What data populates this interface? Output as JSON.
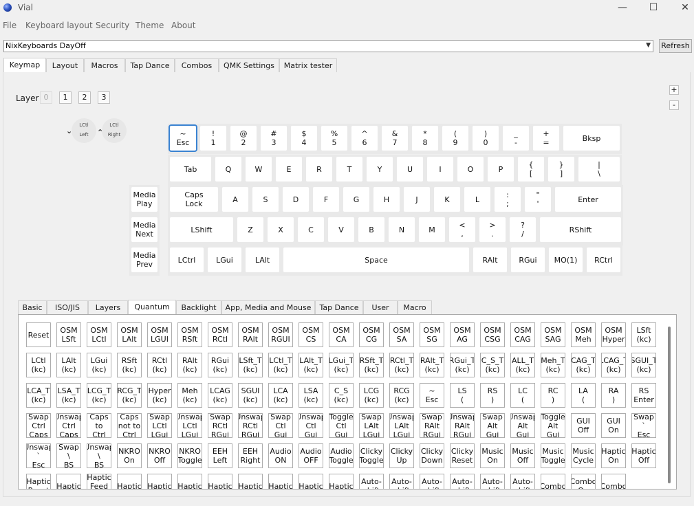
{
  "window": {
    "title": "Vial",
    "minimize": "—",
    "maximize": "☐",
    "close": "✕"
  },
  "menu": [
    "File",
    "Keyboard layout",
    "Security",
    "Theme",
    "About"
  ],
  "keyboard_selector": {
    "value": "NixKeyboards DayOff",
    "refresh_label": "Refresh"
  },
  "main_tabs": [
    "Keymap",
    "Layout",
    "Macros",
    "Tap Dance",
    "Combos",
    "QMK Settings",
    "Matrix tester"
  ],
  "active_main_tab": "Keymap",
  "layer": {
    "label": "Layer",
    "buttons": [
      "0",
      "1",
      "2",
      "3"
    ],
    "active": "0"
  },
  "zoom": {
    "plus": "+",
    "minus": "-"
  },
  "encoders": [
    {
      "top": "LCtl",
      "bottom": "Left"
    },
    {
      "top": "LCtl",
      "bottom": "Right"
    }
  ],
  "encoder_arrows": {
    "ccw": "⌄",
    "cw": "⌃"
  },
  "keymap_rows": [
    [
      "~\nEsc",
      "!\n1",
      "@\n2",
      "#\n3",
      "$\n4",
      "%\n5",
      "^\n6",
      "&\n7",
      "*\n8",
      "(\n9",
      ")\n0",
      "_\n-",
      "+\n=",
      "Bksp"
    ],
    [
      "Tab",
      "Q",
      "W",
      "E",
      "R",
      "T",
      "Y",
      "U",
      "I",
      "O",
      "P",
      "{\n[",
      "}\n]",
      "|\n\\"
    ],
    [
      "Media\nPlay",
      "Caps\nLock",
      "A",
      "S",
      "D",
      "F",
      "G",
      "H",
      "J",
      "K",
      "L",
      ":\n;",
      "\"\n'",
      "Enter"
    ],
    [
      "Media\nNext",
      "LShift",
      "Z",
      "X",
      "C",
      "V",
      "B",
      "N",
      "M",
      "<\n,",
      ">\n.",
      "?\n/",
      "RShift"
    ],
    [
      "Media\nPrev",
      "LCtrl",
      "LGui",
      "LAlt",
      "Space",
      "RAlt",
      "RGui",
      "MO(1)",
      "RCtrl"
    ]
  ],
  "sub_tabs": [
    "Basic",
    "ISO/JIS",
    "Layers",
    "Quantum",
    "Backlight",
    "App, Media and Mouse",
    "Tap Dance",
    "User",
    "Macro"
  ],
  "active_sub_tab": "Quantum",
  "quantum_keys": [
    [
      "Reset",
      "OSM\nLSft",
      "OSM\nLCtl",
      "OSM\nLAlt",
      "OSM\nLGUI",
      "OSM\nRSft",
      "OSM\nRCtl",
      "OSM\nRAlt",
      "OSM\nRGUI",
      "OSM\nCS",
      "OSM\nCA",
      "OSM\nCG",
      "OSM\nSA",
      "OSM\nSG",
      "OSM\nAG",
      "OSM\nCSG",
      "OSM\nCAG",
      "OSM\nSAG",
      "OSM\nMeh",
      "OSM\nHyper",
      "LSft\n(kc)"
    ],
    [
      "LCtl\n(kc)",
      "LAlt\n(kc)",
      "LGui\n(kc)",
      "RSft\n(kc)",
      "RCtl\n(kc)",
      "RAlt\n(kc)",
      "RGui\n(kc)",
      "LSft_T\n(kc)",
      "LCtl_T\n(kc)",
      "LAlt_T\n(kc)",
      "LGui_T\n(kc)",
      "RSft_T\n(kc)",
      "RCtl_T\n(kc)",
      "RAlt_T\n(kc)",
      "RGui_T\n(kc)",
      "C_S_T\n(kc)",
      "ALL_T\n(kc)",
      "Meh_T\n(kc)",
      "CAG_T\n(kc)",
      "LCAG_T\n(kc)",
      "SGUI_T\n(kc)"
    ],
    [
      "LCA_T\n(kc)",
      "LSA_T\n(kc)",
      "LCG_T\n(kc)",
      "RCG_T\n(kc)",
      "Hyper\n(kc)",
      "Meh\n(kc)",
      "LCAG\n(kc)",
      "SGUI\n(kc)",
      "LCA\n(kc)",
      "LSA\n(kc)",
      "C_S\n(kc)",
      "LCG\n(kc)",
      "RCG\n(kc)",
      "~\nEsc",
      "LS\n(",
      "RS\n)",
      "LC\n(",
      "RC\n)",
      "LA\n(",
      "RA\n)",
      "RS\nEnter"
    ],
    [
      "Swap\nCtrl\nCaps",
      "Unswap\nCtrl\nCaps",
      "Caps\nto\nCtrl",
      "Caps\nnot to\nCtrl",
      "Swap\nLCtl\nLGui",
      "Unswap\nLCtl\nLGui",
      "Swap\nRCtl\nRGui",
      "Unswap\nRCtl\nRGui",
      "Swap\nCtl\nGui",
      "Unswap\nCtl\nGui",
      "Toggle\nCtl\nGui",
      "Swap\nLAlt\nLGui",
      "Unswap\nLAlt\nLGui",
      "Swap\nRAlt\nRGui",
      "Unswap\nRAlt\nRGui",
      "Swap\nAlt\nGui",
      "Unswap\nAlt\nGui",
      "Toggle\nAlt\nGui",
      "GUI\nOff",
      "GUI\nOn",
      "Swap\n`\nEsc"
    ],
    [
      "Unswap\n`\nEsc",
      "Swap\n\\\nBS",
      "Unswap\n\\\nBS",
      "NKRO\nOn",
      "NKRO\nOff",
      "NKRO\nToggle",
      "EEH\nLeft",
      "EEH\nRight",
      "Audio\nON",
      "Audio\nOFF",
      "Audio\nToggle",
      "Clicky\nToggle",
      "Clicky\nUp",
      "Clicky\nDown",
      "Clicky\nReset",
      "Music\nOn",
      "Music\nOff",
      "Music\nToggle",
      "Music\nCycle",
      "Haptic\nOn",
      "Haptic\nOff"
    ],
    [
      "Haptic\nReset",
      "Haptic",
      "Haptic\nFeed\nback",
      "Haptic",
      "Haptic",
      "Haptic",
      "Haptic",
      "Haptic",
      "Haptic",
      "Haptic",
      "Haptic",
      "Auto-\nshift",
      "Auto-\nshift",
      "Auto-\nshift",
      "Auto-\nshift",
      "Auto-\nshift",
      "Auto-\nshift",
      "Combo",
      "Combo\nOn",
      "Combo"
    ]
  ]
}
